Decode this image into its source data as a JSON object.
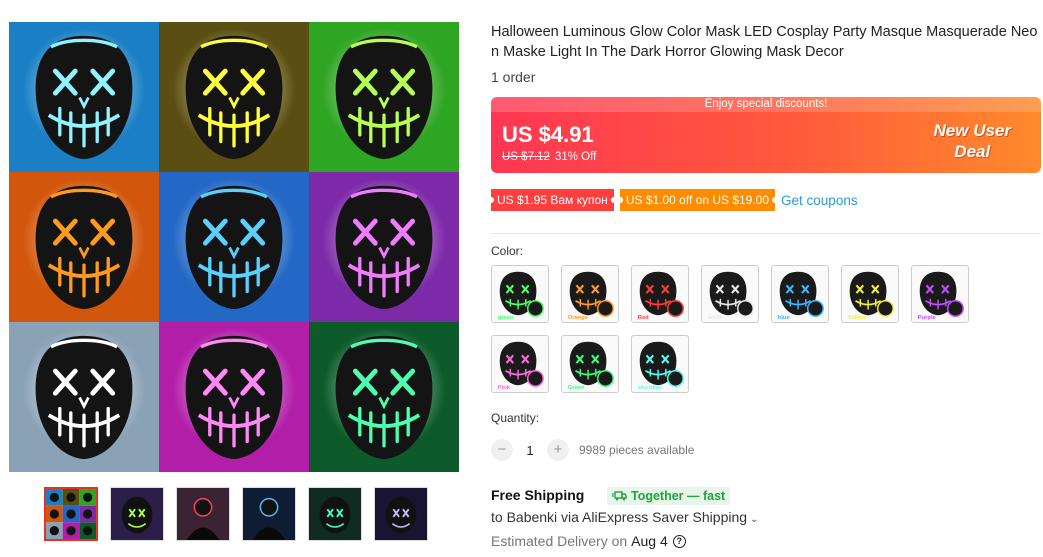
{
  "product": {
    "title": "Halloween Luminous Glow Color Mask LED Cosplay Party Masque Masquerade Neon Maske Light In The Dark Horror Glowing Mask Decor",
    "orders": "1 order"
  },
  "gallery": {
    "tiles": [
      {
        "bg": "#1a7fc4",
        "glow": "#8ff4ff"
      },
      {
        "bg": "#5a4e12",
        "glow": "#ffff3c"
      },
      {
        "bg": "#2fa524",
        "glow": "#b6ff55"
      },
      {
        "bg": "#d2560c",
        "glow": "#ff9a1e"
      },
      {
        "bg": "#2468c6",
        "glow": "#5ad0ff"
      },
      {
        "bg": "#7d2aa8",
        "glow": "#f07dff"
      },
      {
        "bg": "#8aa2b6",
        "glow": "#ffffff"
      },
      {
        "bg": "#b21ea8",
        "glow": "#ff8af5"
      },
      {
        "bg": "#0d5a2a",
        "glow": "#4dffb0"
      }
    ],
    "thumbs": [
      {
        "icon": "collage-thumb-icon",
        "bg": "#2c3a66",
        "glow": "#ff4d4d"
      },
      {
        "icon": "mask-thumb-icon",
        "bg": "#2b1f4a",
        "glow": "#a9ff4a"
      },
      {
        "icon": "person-thumb-icon",
        "bg": "#3a2433",
        "glow": "#ff3f6a"
      },
      {
        "icon": "person-thumb-icon",
        "bg": "#0e1c34",
        "glow": "#5ab8ff"
      },
      {
        "icon": "mask-thumb-icon",
        "bg": "#0f2b22",
        "glow": "#3effc8"
      },
      {
        "icon": "mask-thumb-icon",
        "bg": "#1a1433",
        "glow": "#c6b6ff"
      }
    ]
  },
  "price": {
    "strip": "Enjoy special discounts!",
    "current": "US $4.91",
    "original": "US $7.12",
    "discount": "31% Off",
    "promo_line1": "New User",
    "promo_line2": "Deal",
    "banner_colors": [
      "#ff3653",
      "#ff8a2b"
    ]
  },
  "coupons": {
    "coupon1": "US $1.95 Вам купон",
    "coupon2": "US $1.00 off on US $19.00",
    "get": "Get coupons"
  },
  "color": {
    "label": "Color:",
    "options": [
      {
        "label": "green",
        "glow": "#4dff6a"
      },
      {
        "label": "Orange",
        "glow": "#ff9a2c"
      },
      {
        "label": "Red",
        "glow": "#ff3a3a"
      },
      {
        "label": "white",
        "glow": "#e8e8e8"
      },
      {
        "label": "blue",
        "glow": "#3ab8ff"
      },
      {
        "label": "Yellow",
        "glow": "#f0f03c"
      },
      {
        "label": "Purple",
        "glow": "#c24dff"
      },
      {
        "label": "Pink",
        "glow": "#ff6ad9"
      },
      {
        "label": "Green",
        "glow": "#3cff7a"
      },
      {
        "label": "sky blue",
        "glow": "#4dfff2"
      }
    ]
  },
  "quantity": {
    "label": "Quantity:",
    "minus": "−",
    "value": "1",
    "plus": "+",
    "available": "9989 pieces available"
  },
  "shipping": {
    "title": "Free Shipping",
    "badge": "Together — fast",
    "line": "to Babenki via AliExpress Saver Shipping",
    "chevron": "⌄",
    "delivery_label": "Estimated Delivery on",
    "delivery_date": "Aug 4",
    "help": "?"
  }
}
